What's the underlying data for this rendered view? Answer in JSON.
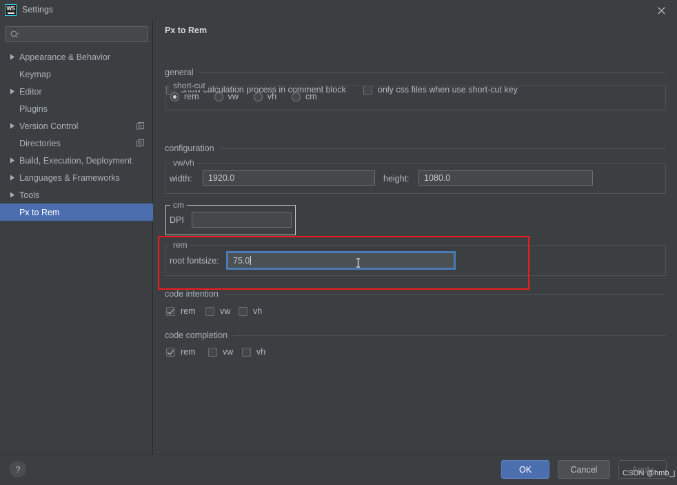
{
  "window": {
    "title": "Settings",
    "logo_text": "WS",
    "close_icon": "close-icon"
  },
  "sidebar": {
    "search": {
      "placeholder": "",
      "value": "",
      "icon": "search-icon"
    },
    "items": [
      {
        "label": "Appearance & Behavior",
        "expandable": true,
        "selected": false,
        "trailing_icon": ""
      },
      {
        "label": "Keymap",
        "expandable": false,
        "selected": false,
        "trailing_icon": ""
      },
      {
        "label": "Editor",
        "expandable": true,
        "selected": false,
        "trailing_icon": ""
      },
      {
        "label": "Plugins",
        "expandable": false,
        "selected": false,
        "trailing_icon": ""
      },
      {
        "label": "Version Control",
        "expandable": true,
        "selected": false,
        "trailing_icon": "copy-icon"
      },
      {
        "label": "Directories",
        "expandable": false,
        "selected": false,
        "trailing_icon": "copy-icon"
      },
      {
        "label": "Build, Execution, Deployment",
        "expandable": true,
        "selected": false,
        "trailing_icon": ""
      },
      {
        "label": "Languages & Frameworks",
        "expandable": true,
        "selected": false,
        "trailing_icon": ""
      },
      {
        "label": "Tools",
        "expandable": true,
        "selected": false,
        "trailing_icon": ""
      },
      {
        "label": "Px to Rem",
        "expandable": false,
        "selected": true,
        "trailing_icon": ""
      }
    ]
  },
  "content": {
    "page_title": "Px to Rem",
    "general": {
      "header": "general",
      "checkbox_comment_block": {
        "label": "show calculation process in comment block",
        "checked": false
      },
      "checkbox_only_css": {
        "label": "only css files when use short-cut key",
        "checked": false
      },
      "shortcut_group": {
        "title": "short-cut",
        "options": [
          {
            "label": "rem",
            "selected": true
          },
          {
            "label": "vw",
            "selected": false
          },
          {
            "label": "vh",
            "selected": false
          },
          {
            "label": "cm",
            "selected": false
          }
        ]
      }
    },
    "configuration": {
      "header": "configuration",
      "vwvh_group": {
        "title": "vw/vh",
        "width_label": "width:",
        "width_value": "1920.0",
        "height_label": "height:",
        "height_value": "1080.0"
      },
      "cm_group": {
        "title": "cm",
        "dpi_label": "DPI",
        "dpi_value": ""
      },
      "rem_group": {
        "title": "rem",
        "root_fontsize_label": "root fontsize:",
        "root_fontsize_value": "75.0",
        "focused": true,
        "highlight_color": "#f01b1b"
      }
    },
    "code_intention": {
      "header": "code intention",
      "options": [
        {
          "label": "rem",
          "checked": true
        },
        {
          "label": "vw",
          "checked": false
        },
        {
          "label": "vh",
          "checked": false
        }
      ]
    },
    "code_completion": {
      "header": "code completion",
      "options": [
        {
          "label": "rem",
          "checked": true
        },
        {
          "label": "vw",
          "checked": false
        },
        {
          "label": "vh",
          "checked": false
        }
      ]
    }
  },
  "footer": {
    "help_glyph": "?",
    "ok_label": "OK",
    "cancel_label": "Cancel",
    "apply_label": "Apply"
  },
  "watermark": "CSDN @hmb_j",
  "colors": {
    "background": "#3c3f41",
    "selection": "#4b6eaf",
    "accent_focus": "#4b7bb5",
    "highlight_red": "#f01b1b",
    "logo_border": "#3ac9e0"
  }
}
